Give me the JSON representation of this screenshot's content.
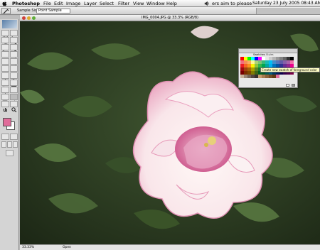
{
  "menubar": {
    "app_name": "Photoshop",
    "items": [
      "File",
      "Edit",
      "Image",
      "Layer",
      "Select",
      "Filter",
      "View",
      "Window",
      "Help"
    ],
    "extra_text": "ers aim to please",
    "clock": "Saturday 23 July 2005 08:43 AM"
  },
  "options_bar": {
    "sample_size_label": "Sample Size:",
    "sample_size_value": "Point Sample"
  },
  "toolbox": {
    "foreground_color": "#e06c9a",
    "background_color": "#ffffff",
    "tools": [
      "marquee",
      "move",
      "lasso",
      "magic-wand",
      "crop",
      "slice",
      "healing",
      "brush",
      "stamp",
      "history-brush",
      "eraser",
      "gradient",
      "blur",
      "dodge",
      "path-select",
      "type",
      "pen",
      "shape",
      "notes",
      "eyedropper",
      "hand",
      "zoom"
    ]
  },
  "document": {
    "title": "IMG_0004.JPG @ 33.3% (RGB/8)",
    "zoom_status": "33.33%",
    "status_text": "Open"
  },
  "swatches_panel": {
    "tab_label": "Swatches",
    "tab2_label": "Styles",
    "tooltip": "Create new swatch of foreground color"
  }
}
